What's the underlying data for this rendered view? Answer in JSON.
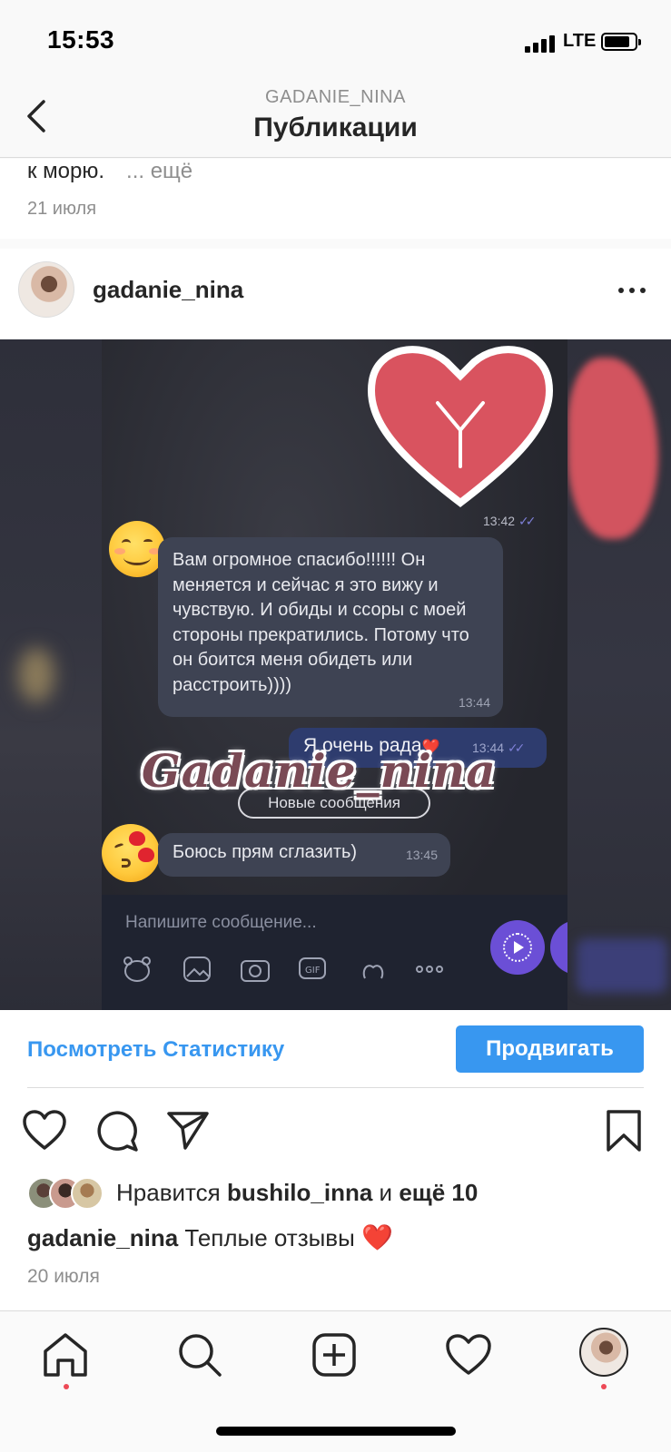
{
  "status_bar": {
    "time": "15:53",
    "network": "LTE",
    "battery_level": 0.85
  },
  "nav": {
    "subtitle": "GADANIE_NINA",
    "title": "Публикации"
  },
  "previous_post": {
    "caption_tail": "к морю.",
    "more": "... ещё",
    "date": "21 июля"
  },
  "post": {
    "username": "gadanie_nina",
    "image": {
      "time_top": "13:42",
      "incoming_message": "Вам огромное спасибо!!!!!! Он меняется и сейчас я это вижу и чувствую. И обиды и ссоры с моей стороны прекратились. Потому что он боится  меня обидеть или расстроить))))",
      "incoming_time": "13:44",
      "outgoing_message": "Я очень рада",
      "outgoing_heart": "❤️",
      "outgoing_time": "13:44",
      "new_messages": "Новые сообщения",
      "watermark": "Gadanie_nina",
      "incoming_message2": "Боюсь прям сглазить)",
      "incoming_time2": "13:45",
      "composer_placeholder": "Напишите сообщение..."
    },
    "stats_link": "Посмотреть Статистику",
    "promote_button": "Продвигать",
    "likes_prefix": "Нравится",
    "likes_user": "bushilo_inna",
    "likes_and": "и",
    "likes_more": "ещё 10",
    "caption_user": "gadanie_nina",
    "caption_text": "Теплые отзывы",
    "caption_emoji": "❤️",
    "date": "20 июля"
  },
  "colors": {
    "accent": "#3897f0",
    "notification_dot": "#ed4956",
    "heart": "#e0242f"
  },
  "icons": [
    "back-chevron-icon",
    "more-dots-icon",
    "like-heart-icon",
    "comment-icon",
    "share-icon",
    "bookmark-icon",
    "home-icon",
    "search-icon",
    "new-post-icon",
    "activity-heart-icon",
    "profile-avatar"
  ]
}
